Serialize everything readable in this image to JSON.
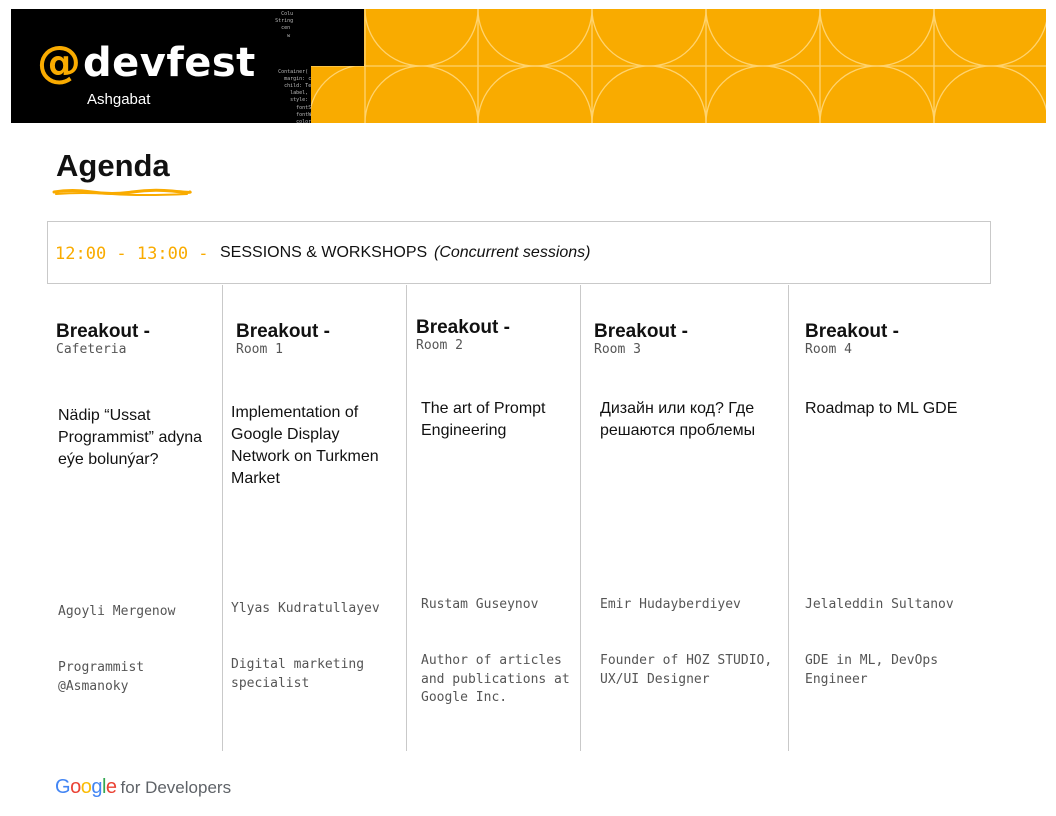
{
  "colors": {
    "accent": "#f9ab00",
    "banner_black": "#000000",
    "divider": "#c9c9c9"
  },
  "banner": {
    "at_symbol": "@",
    "wordmark": "devfest",
    "city": "Ashgabat"
  },
  "agenda": {
    "title": "Agenda"
  },
  "session": {
    "time": "12:00 - 13:00 -",
    "label": "SESSIONS &  WORKSHOPS",
    "note": "(Concurrent sessions)"
  },
  "columns": [
    {
      "breakout": "Breakout -",
      "room": "Cafeteria",
      "talk": [
        "Nädip “Ussat",
        "Programmist” adyna",
        "eýe bolunýar?"
      ],
      "speaker": "Agoyli Mergenow",
      "role": [
        "Programmist",
        "@Asmanoky"
      ]
    },
    {
      "breakout": "Breakout -",
      "room": "Room 1",
      "talk": [
        "Implementation of",
        "Google Display",
        "Network on Turkmen",
        "Market"
      ],
      "speaker": "Ylyas Kudratullayev",
      "role": [
        "Digital marketing",
        "specialist"
      ]
    },
    {
      "breakout": "Breakout -",
      "room": "Room 2",
      "talk": [
        "The art of Prompt",
        "Engineering"
      ],
      "speaker": "Rustam Guseynov",
      "role": [
        "Author of articles",
        "and publications at",
        "Google Inc."
      ]
    },
    {
      "breakout": "Breakout -",
      "room": "Room 3",
      "talk": [
        "Дизайн или код? Где",
        "решаются проблемы"
      ],
      "speaker": "Emir Hudayberdiyev",
      "role": [
        "Founder of HOZ STUDIO,",
        "UX/UI Designer"
      ]
    },
    {
      "breakout": "Breakout -",
      "room": "Room 4",
      "talk": [
        "Roadmap to ML GDE"
      ],
      "speaker": "Jelaleddin Sultanov",
      "role": [
        "GDE in ML, DevOps",
        "Engineer"
      ]
    }
  ],
  "footer": {
    "g1": "G",
    "g2": "o",
    "g3": "o",
    "g4": "g",
    "g5": "l",
    "g6": "e",
    "rest": "for Developers"
  }
}
